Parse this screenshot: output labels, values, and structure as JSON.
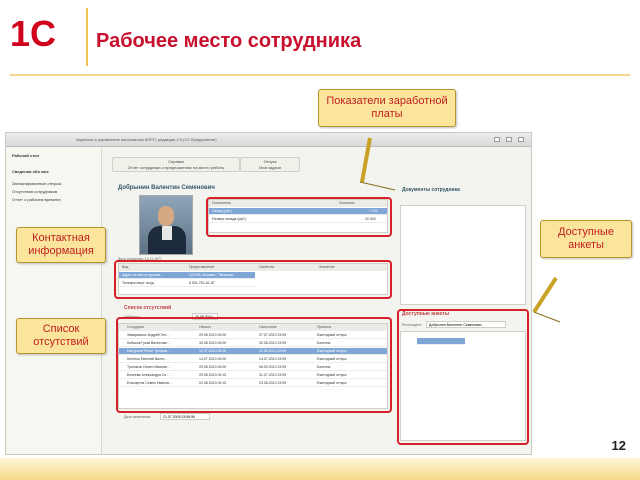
{
  "header": {
    "logo_text": "1С",
    "title": "Рабочее место сотрудника"
  },
  "callouts": {
    "salary": "Показатели заработной платы",
    "contacts": "Контактная информация",
    "absences": "Список отсутствий",
    "forms": "Доступные анкеты"
  },
  "app": {
    "window_title": "Зарплата и управление персоналом КОРП, редакция 2.5 (1С:Предприятие)",
    "left_panel": {
      "items": [
        "Рабочий стол",
        "Сведения обо мне",
        "Запланированные отпуска",
        "Отсутствия сотрудников",
        "Отчет о рабочем времени"
      ]
    },
    "toolbar": {
      "btn1_title": "Справки",
      "btn1_sub": "Отчет сотрудника о предложениях на место работы",
      "btn2_title": "Отпуск",
      "btn2_sub": "Мои задачи"
    },
    "employee_name": "Добрынин Валентин Семенович",
    "salary_grid": {
      "headers": [
        "Показатель",
        "Значение"
      ],
      "rows": [
        [
          "Оклад (руб.)",
          "7 100"
        ],
        [
          "Размер оклада (руб.)",
          "20 000"
        ]
      ]
    },
    "birth_label": "Дата рождения: 14.11.1977",
    "contacts_grid": {
      "headers": [
        "Вид",
        "Представление",
        "Свойство",
        "Значение"
      ],
      "rows": [
        [
          "Адрес по месту прожив...",
          "121196, Москва г, Тверская..."
        ],
        [
          "Телефон внут. вход",
          "8 901-751-61-87"
        ]
      ]
    },
    "absences": {
      "title": "Список отсутствий",
      "filter_label": "Отбирать",
      "date_from": "20.08.2010",
      "headers": [
        "Сотрудник",
        "Начало",
        "Окончание",
        "Причина"
      ],
      "rows": [
        [
          "Заварзиных Андрей Ген...",
          "25.08.2010 00:00",
          "27.07.2010 23:59",
          "Ежегодный отпуск"
        ],
        [
          "Кобасов Грым Вячеслав...",
          "30.08.2010 00:00",
          "30.08.2010 23:59",
          "Болезнь"
        ],
        [
          "Насуроев Ренат Трофим...",
          "12.07.2010 00:00",
          "12.08.2010 23:59",
          "Ежегодный отпуск"
        ],
        [
          "Котенок Евгений Викто...",
          "14.07.2010 00:00",
          "14.07.2010 23:59",
          "Ежегодный отпуск"
        ],
        [
          "Тусликов Семен Иванов...",
          "25.08.2010 00:00",
          "06.09.2010 23:59",
          "Болезнь"
        ],
        [
          "Бекеева Александра Се...",
          "25.08.2010 09:15",
          "31.07.2010 23:59",
          "Ежегодный отпуск"
        ],
        [
          "Елисартов Семен Иванов...",
          "02.08.2010 09:15",
          "03.08.2010 23:59",
          "Ежегодный отпуск"
        ]
      ],
      "date_field": "21.07.2009 23:59:59"
    },
    "documents_title": "Документы сотрудника",
    "forms": {
      "title": "Доступные анкеты",
      "respondent_label": "Респондент:",
      "respondent": "Добрынин Валентин Семенович"
    }
  },
  "page_number": "12",
  "colors": {
    "accent_red": "#c8102e",
    "callout_bg": "#fbe49c",
    "highlight_border": "#d8202a"
  }
}
